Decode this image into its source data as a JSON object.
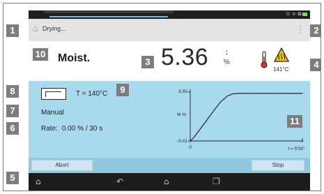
{
  "status_bar": {
    "icons": "⊙ ᯤ ⊠"
  },
  "action_bar": {
    "title": "Drying...",
    "overflow_menu": "⋮"
  },
  "measurement": {
    "mode_label": "Moist.",
    "value": "5.36",
    "unit_colon": ":",
    "unit": "%",
    "temperature": "141°C"
  },
  "program": {
    "temperature_setting": "T = 140°C",
    "switch_off_mode": "Manual",
    "rate_label": "Rate:",
    "rate_value": "0.00 % / 30 s"
  },
  "chart_data": {
    "type": "line",
    "ylabel": "M %",
    "y_ticks": [
      "5.50",
      "-0.01"
    ],
    "x_ticks": [
      "0",
      "t = 5'03\""
    ],
    "ylim": [
      -0.01,
      5.5
    ],
    "xlim_seconds": [
      0,
      303
    ],
    "series": [
      {
        "x_seconds": [
          0,
          10,
          30,
          60,
          80,
          100,
          115,
          130,
          160,
          200,
          250,
          303
        ],
        "y": [
          -0.01,
          0.4,
          1.5,
          3.2,
          4.3,
          5.05,
          5.3,
          5.36,
          5.36,
          5.37,
          5.36,
          5.36
        ]
      }
    ]
  },
  "buttons": {
    "abort": "Abort",
    "stop": "Stop"
  },
  "nav": {
    "home_alt": "⌂",
    "back": "↶",
    "home": "⌂",
    "recents": "❐"
  },
  "callouts": [
    "1",
    "2",
    "3",
    "4",
    "5",
    "6",
    "7",
    "8",
    "9",
    "10",
    "11"
  ]
}
